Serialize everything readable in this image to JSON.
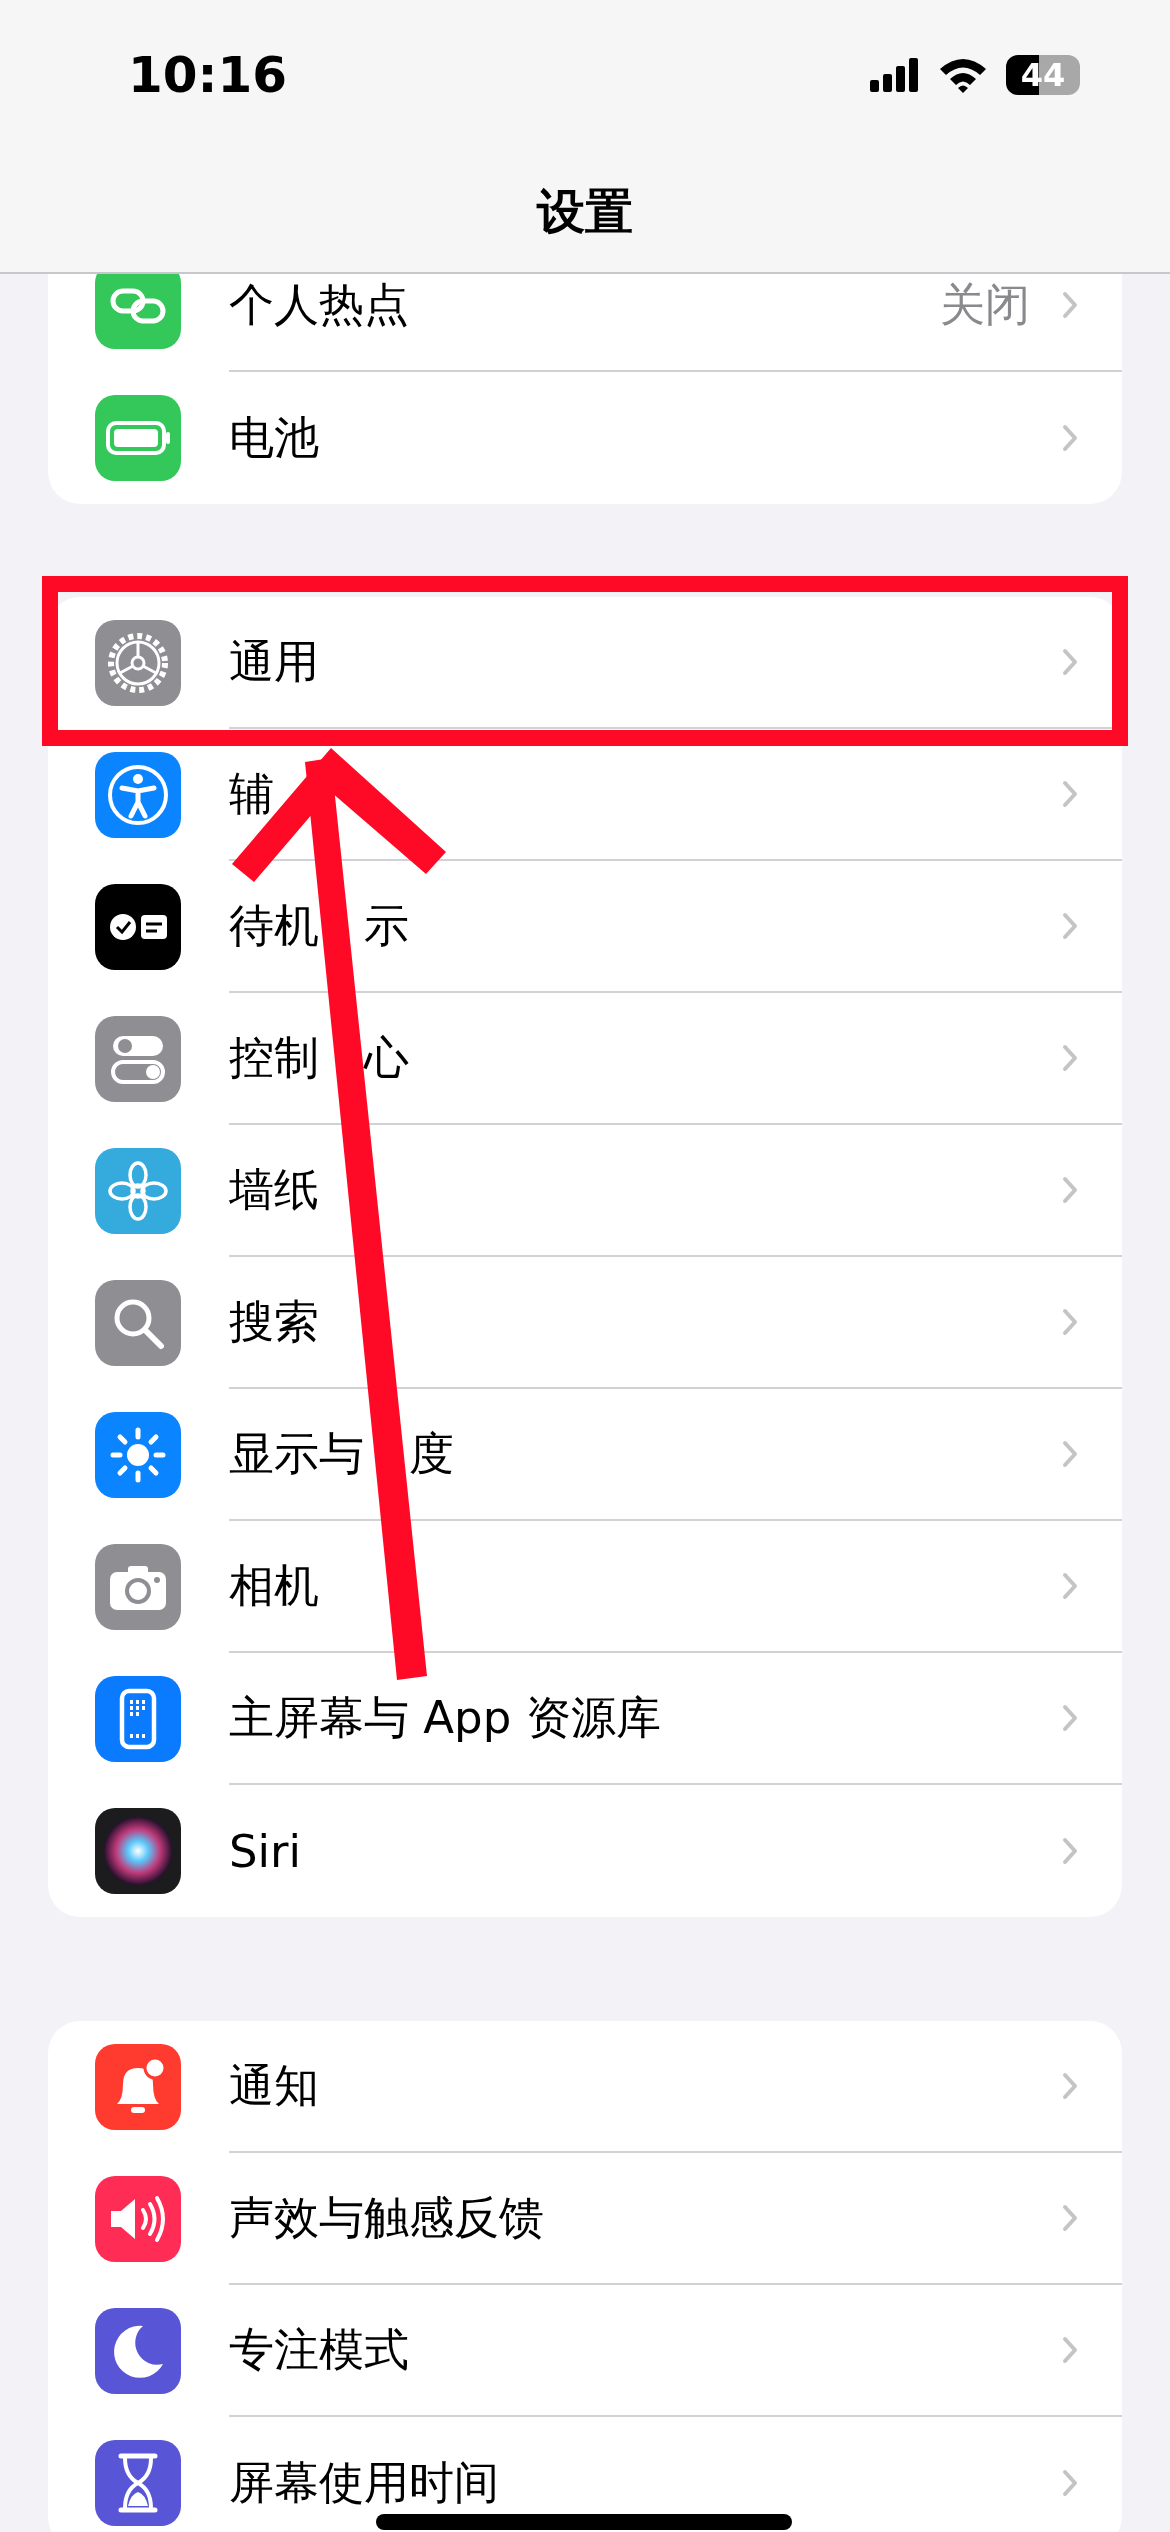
{
  "status_bar": {
    "time": "10:16",
    "battery": "44"
  },
  "nav": {
    "title": "设置"
  },
  "groups": [
    {
      "rows": [
        {
          "color": "#34c759",
          "label": "个人热点",
          "value": "关闭"
        },
        {
          "color": "#34c759",
          "label": "电池"
        }
      ]
    },
    {
      "rows": [
        {
          "color": "#8e8e93",
          "label": "通用"
        },
        {
          "color": "#0a84ff",
          "label": "辅"
        },
        {
          "color": "#000000",
          "label": "待机",
          "label_end": "示"
        },
        {
          "color": "#8e8e93",
          "label": "控制",
          "label_end": "心"
        },
        {
          "color": "#35aadc",
          "label": "墙纸"
        },
        {
          "color": "#8e8e93",
          "label": "搜索"
        },
        {
          "color": "#0a84ff",
          "label": "显示与",
          "label_end": "度"
        },
        {
          "color": "#8e8e93",
          "label": "相机"
        },
        {
          "color": "#0a7aff",
          "label": "主屏幕与 App 资源库"
        },
        {
          "color": "#1c1c1e",
          "label": "Siri"
        }
      ]
    },
    {
      "rows": [
        {
          "color": "#ff3b30",
          "label": "通知"
        },
        {
          "color": "#ff2d55",
          "label": "声效与触感反馈"
        },
        {
          "color": "#5856d6",
          "label": "专注模式"
        },
        {
          "color": "#5856d6",
          "label": "屏幕使用时间"
        }
      ]
    }
  ]
}
